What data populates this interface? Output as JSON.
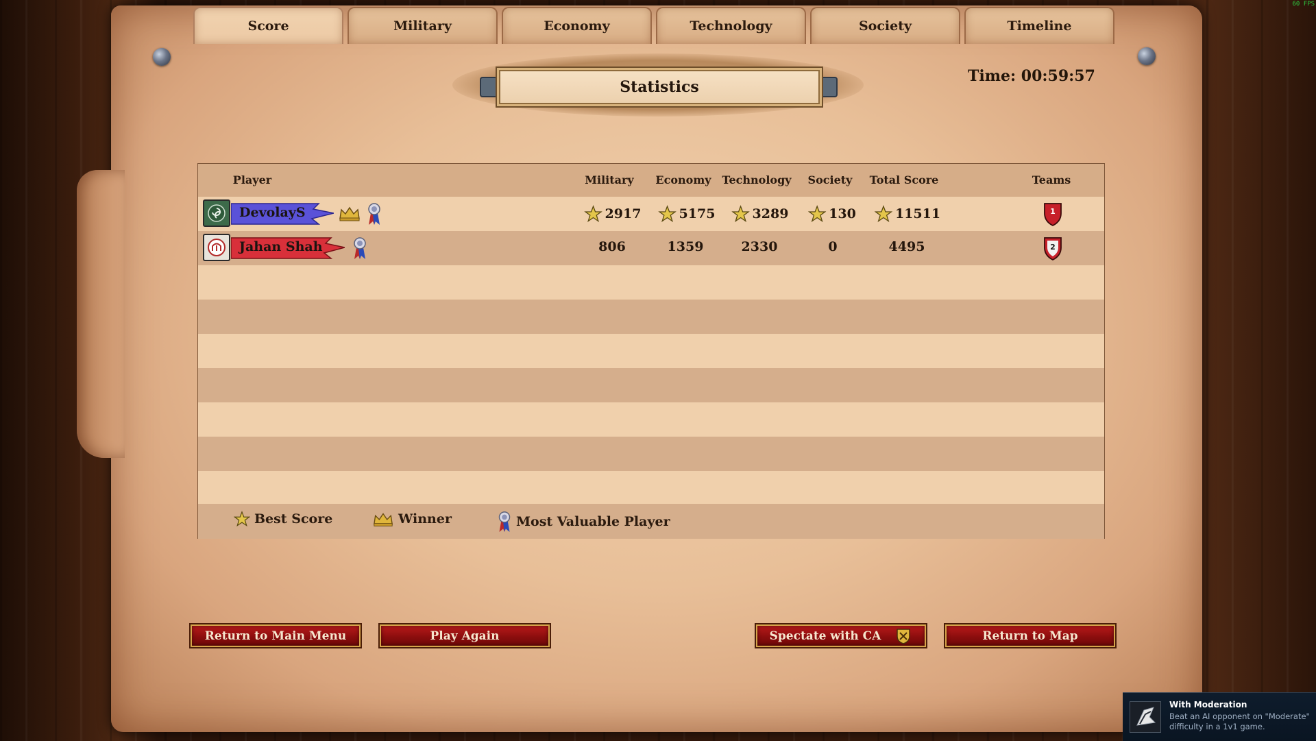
{
  "fps": "60 FPS",
  "tabs": [
    {
      "label": "Score",
      "active": true
    },
    {
      "label": "Military"
    },
    {
      "label": "Economy"
    },
    {
      "label": "Technology"
    },
    {
      "label": "Society"
    },
    {
      "label": "Timeline"
    }
  ],
  "title": "Statistics",
  "time": "Time: 00:59:57",
  "table": {
    "headers": {
      "player": "Player",
      "military": "Military",
      "economy": "Economy",
      "technology": "Technology",
      "society": "Society",
      "total": "Total Score",
      "teams": "Teams"
    },
    "rows": [
      {
        "name": "DevolayS",
        "color": "#5a52d8",
        "military": "2917",
        "economy": "5175",
        "technology": "3289",
        "society": "130",
        "total": "11511",
        "best": [
          true,
          true,
          true,
          true,
          true
        ],
        "winner": true,
        "mvp": true,
        "team": "1",
        "team_color": "#c7202a"
      },
      {
        "name": "Jahan Shah",
        "color": "#d8303a",
        "military": "806",
        "economy": "1359",
        "technology": "2330",
        "society": "0",
        "total": "4495",
        "best": [
          false,
          false,
          false,
          false,
          false
        ],
        "winner": false,
        "mvp": true,
        "team": "2",
        "team_color": "#c7202a"
      }
    ]
  },
  "legend": {
    "best_score": "Best Score",
    "winner": "Winner",
    "mvp": "Most Valuable Player"
  },
  "buttons": {
    "main_menu": "Return to Main Menu",
    "play_again": "Play Again",
    "spectate": "Spectate with CA",
    "return_map": "Return to Map"
  },
  "toast": {
    "title": "With Moderation",
    "description": "Beat an AI opponent on \"Moderate\" difficulty in a 1v1 game."
  },
  "icons": {
    "best": "star-icon",
    "winner": "crown-icon",
    "mvp": "medal-icon",
    "team": "shield-icon",
    "spectate": "ca-emblem-icon"
  }
}
